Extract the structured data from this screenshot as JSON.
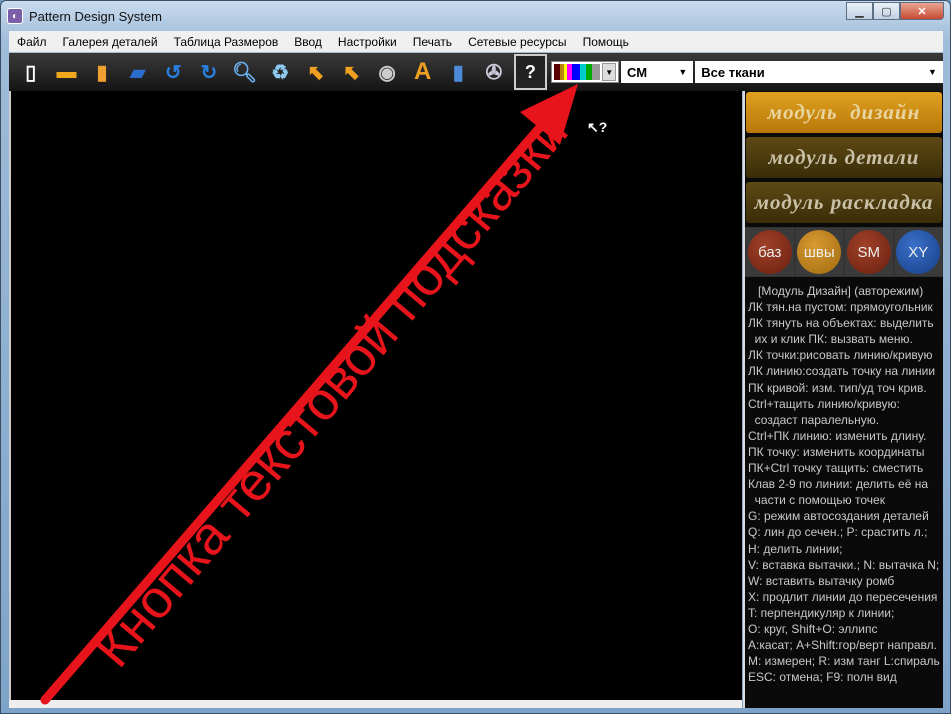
{
  "window": {
    "title": "Pattern Design System",
    "minimize": "▁",
    "maximize": "▢",
    "close": "✕"
  },
  "menu": [
    "Файл",
    "Галерея деталей",
    "Таблица Размеров",
    "Ввод",
    "Настройки",
    "Печать",
    "Сетевые ресурсы",
    "Помощь"
  ],
  "toolbar": {
    "icons": [
      "new-file",
      "open-folder",
      "save",
      "add-folder",
      "undo",
      "redo",
      "zoom",
      "recycle",
      "arrow-select",
      "arrow-curve-select",
      "ring",
      "text",
      "ruler",
      "film-reel"
    ],
    "help_label": "?",
    "unit": "СМ",
    "fabric": "Все ткани"
  },
  "modules": [
    "модуль  дизайн",
    "модуль детали",
    "модуль раскладка"
  ],
  "circle_buttons": [
    {
      "label": "баз",
      "color": "#7a2a14"
    },
    {
      "label": "швы",
      "color": "#b8801c"
    },
    {
      "label": "SM",
      "color": "#7a2a14"
    },
    {
      "label": "XY",
      "color": "#1e4fa0"
    }
  ],
  "help_lines": [
    "   [Модуль Дизайн] (авторежим)",
    "ЛК тян.на пустом: прямоугольник",
    "ЛК тянуть на объектах: выделить",
    "  их и клик ПК: вызвать меню.",
    "ЛК точки:рисовать линию/кривую",
    "ЛК линию:создать точку на линии",
    "ПК кривой: изм. тип/уд точ крив.",
    "Ctrl+тащить линию/кривую:",
    "  создаст паралельную.",
    "Ctrl+ПК линию: изменить длину.",
    "ПК точку: изменить координаты",
    "ПК+Ctrl точку тащить: сместить",
    "Клав 2-9 по линии: делить её на",
    "  части с помощью точек",
    "G: режим автосоздания деталей",
    "Q: лин до сечен.; P: срастить л.;",
    "H: делить линии;",
    "V: вставка вытачки.; N: вытачка N;",
    "W: вставить вытачку ромб",
    "X: продлит линии до пересечения",
    "T: перпендикуляр к линии;",
    "O: круг, Shift+O: эллипс",
    "A:касат; A+Shift:гор/верт направл.",
    "M: измерен; R: изм танг L:спираль",
    "ESC: отмена; F9: полн вид"
  ],
  "annotation": {
    "text": "Кнопка текстовой подсказки",
    "color": "#e8141c"
  }
}
